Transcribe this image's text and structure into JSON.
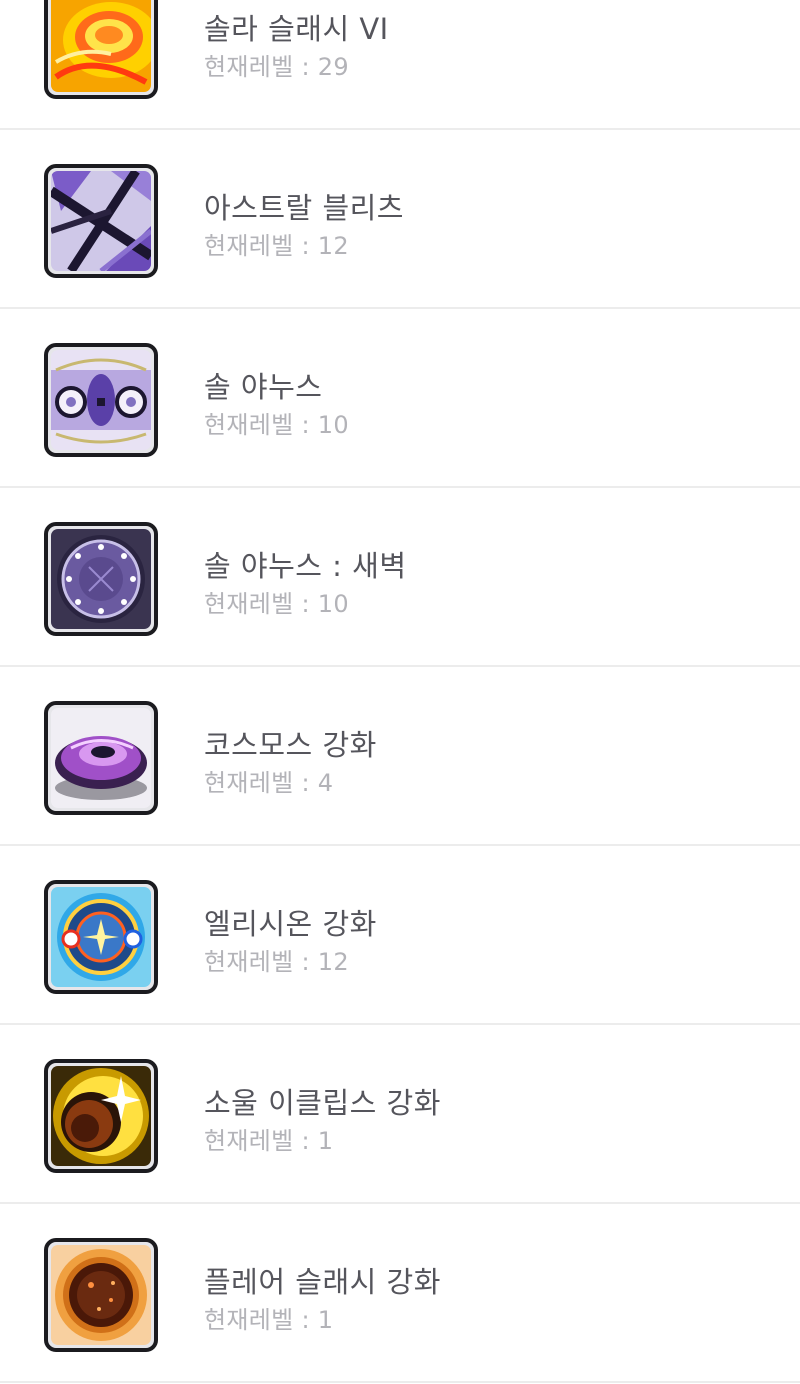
{
  "skills": [
    {
      "name": "솔라 슬래시 VI",
      "level_label": "현재레벨 : 29",
      "level": 29,
      "icon": "solar-slash-icon",
      "accent": "#f5a000"
    },
    {
      "name": "아스트랄 블리츠",
      "level_label": "현재레벨 : 12",
      "level": 12,
      "icon": "astral-blitz-icon",
      "accent": "#7b5cc8"
    },
    {
      "name": "솔 야누스",
      "level_label": "현재레벨 : 10",
      "level": 10,
      "icon": "sol-janus-icon",
      "accent": "#9a8ad8"
    },
    {
      "name": "솔 야누스 : 새벽",
      "level_label": "현재레벨 : 10",
      "level": 10,
      "icon": "sol-janus-dawn-icon",
      "accent": "#5a4a8e"
    },
    {
      "name": "코스모스 강화",
      "level_label": "현재레벨 : 4",
      "level": 4,
      "icon": "cosmos-enhance-icon",
      "accent": "#a050c8"
    },
    {
      "name": "엘리시온 강화",
      "level_label": "현재레벨 : 12",
      "level": 12,
      "icon": "elysion-enhance-icon",
      "accent": "#30a8e8"
    },
    {
      "name": "소울 이클립스 강화",
      "level_label": "현재레벨 : 1",
      "level": 1,
      "icon": "soul-eclipse-enhance-icon",
      "accent": "#e8b800"
    },
    {
      "name": "플레어 슬래시 강화",
      "level_label": "현재레벨 : 1",
      "level": 1,
      "icon": "flare-slash-enhance-icon",
      "accent": "#d07018"
    }
  ]
}
